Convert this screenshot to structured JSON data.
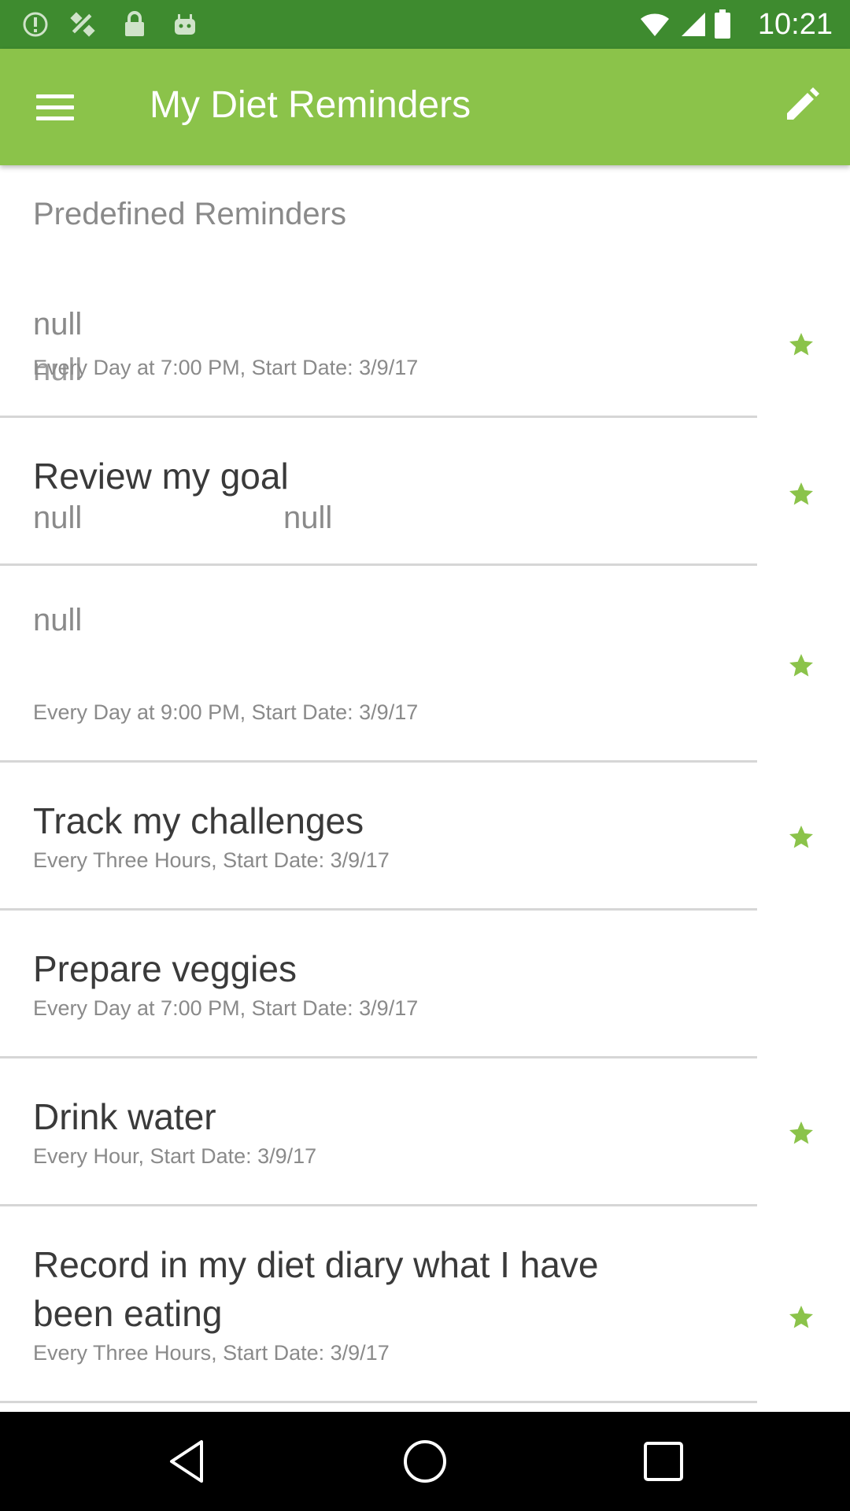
{
  "status_bar": {
    "time": "10:21",
    "icons": [
      "alert-icon",
      "fake-gps-icon",
      "lock-icon",
      "android-icon",
      "wifi-icon",
      "signal-icon",
      "battery-icon"
    ]
  },
  "app_bar": {
    "title": "My Diet Reminders",
    "menu_icon": "hamburger-menu-icon",
    "edit_icon": "pencil-icon",
    "background": "#8bc34a"
  },
  "section": {
    "header": "Predefined Reminders"
  },
  "reminders": [
    {
      "title": "null",
      "title_style": "grey",
      "overlap_text": "null",
      "subtitle": "Every Day at 7:00 PM, Start Date: 3/9/17",
      "starred": true
    },
    {
      "title": "Review my goal",
      "subtitle_left": "null",
      "subtitle_right": "null",
      "starred": true
    },
    {
      "title": "null",
      "title_style": "grey",
      "subtitle": "Every Day at 9:00 PM, Start Date: 3/9/17",
      "starred": true
    },
    {
      "title": "Track my challenges",
      "subtitle": "Every Three Hours,  Start Date: 3/9/17",
      "starred": true
    },
    {
      "title": "Prepare veggies",
      "subtitle": "Every Day at 7:00 PM, Start Date: 3/9/17",
      "starred": false
    },
    {
      "title": "Drink water",
      "subtitle": "Every Hour,  Start Date: 3/9/17",
      "starred": true
    },
    {
      "title_line1": "Record in my diet diary what I have",
      "title_line2": "been eating",
      "subtitle": "Every Three Hours,  Start Date: 3/9/17",
      "starred": true
    }
  ],
  "accent_color": "#8bc34a",
  "nav_bar": {
    "icons": [
      "back-icon",
      "home-icon",
      "recents-icon"
    ]
  }
}
